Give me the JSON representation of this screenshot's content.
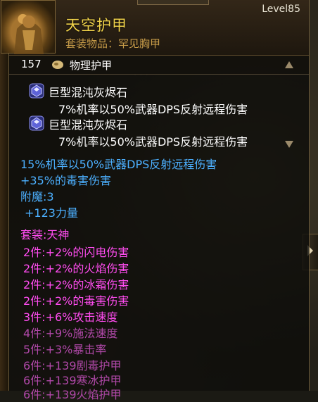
{
  "item": {
    "name": "天空护甲",
    "type": "套装物品：罕见胸甲",
    "level": "Level85"
  },
  "armor": {
    "value": "157",
    "label": "物理护甲"
  },
  "gems": [
    {
      "name": "巨型混沌灰烬石",
      "effect": "7%机率以50%武器DPS反射远程伤害"
    },
    {
      "name": "巨型混沌灰烬石",
      "effect": "7%机率以50%武器DPS反射远程伤害"
    }
  ],
  "properties": {
    "p1": "15%机率以50%武器DPS反射远程伤害",
    "p2": "+35%的毒害伤害",
    "enchant_label": "附魔:3",
    "enchant_value": "+123力量"
  },
  "set": {
    "title": "套装:天神",
    "bonuses": [
      "2件:+2%的闪电伤害",
      "2件:+2%的火焰伤害",
      "2件:+2%的冰霜伤害",
      "2件:+2%的毒害伤害",
      "3件:+6%攻击速度",
      "4件:+9%施法速度",
      "5件:+3%暴击率",
      "6件:+139剧毒护甲",
      "6件:+139寒冰护甲",
      "6件:+139火焰护甲"
    ]
  },
  "colors": {
    "name_gold": "#f0d24a",
    "type_brown": "#c59a48",
    "magic_blue": "#4cb0ff",
    "set_active": "#ff4cf0",
    "set_inactive": "#b048a8"
  }
}
